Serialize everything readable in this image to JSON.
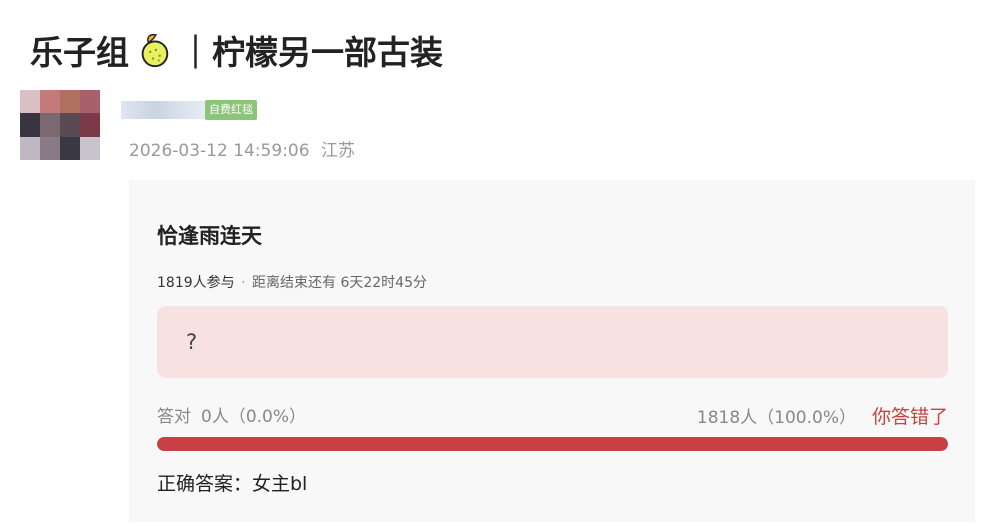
{
  "post": {
    "group_name": "乐子组",
    "separator": "｜",
    "post_title": "柠檬另一部古装",
    "badge": "自费红毯",
    "datetime": "2026-03-12 14:59:06",
    "location": "江苏"
  },
  "poll": {
    "title": "恰逢雨连天",
    "participants": "1819人参与",
    "dot": "·",
    "time_remaining": "距离结束还有 6天22时45分",
    "option_text": "?",
    "correct_label": "答对",
    "correct_count": "0人（0.0%）",
    "wrong_count": "1818人（100.0%）",
    "result_status": "你答错了",
    "wrong_fraction": 1.0,
    "answer_text": "正确答案：女主bl"
  },
  "colors": {
    "badge": "#8cc47a",
    "bar_fill": "#c84046",
    "option_bg": "#f7e1e1",
    "status_red": "#cc4040"
  },
  "icons": {
    "title_icon": "lemon-icon"
  }
}
